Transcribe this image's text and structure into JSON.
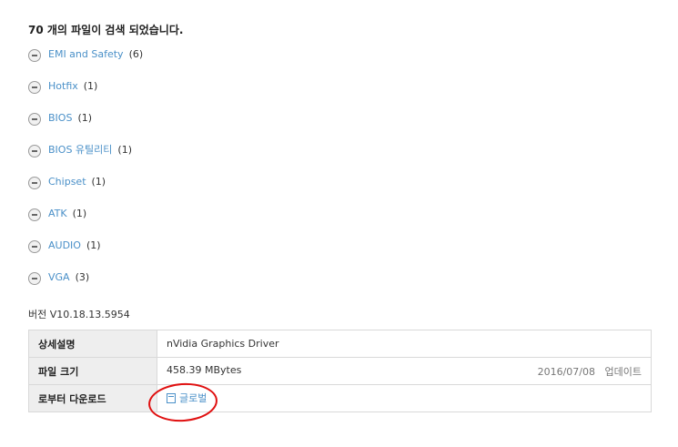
{
  "result_summary": "70 개의 파일이 검색 되었습니다.",
  "categories": [
    {
      "name": "EMI and Safety",
      "count": "(6)"
    },
    {
      "name": "Hotfix",
      "count": "(1)"
    },
    {
      "name": "BIOS",
      "count": "(1)"
    },
    {
      "name": "BIOS 유틸리티",
      "count": "(1)"
    },
    {
      "name": "Chipset",
      "count": "(1)"
    },
    {
      "name": "ATK",
      "count": "(1)"
    },
    {
      "name": "AUDIO",
      "count": "(1)"
    },
    {
      "name": "VGA",
      "count": "(3)"
    }
  ],
  "version_label": "버전 V10.18.13.5954",
  "details": {
    "description_label": "상세설명",
    "description_value": "nVidia Graphics Driver",
    "size_label": "파일 크기",
    "size_value": "458.39 MBytes",
    "date_value": "2016/07/08",
    "update_label": "업데이트",
    "download_label": "로부터 다운로드",
    "download_link": "글로벌"
  },
  "colors": {
    "link": "#4a90c8",
    "header_bg": "#eeeeee",
    "annotation": "#e01010"
  }
}
